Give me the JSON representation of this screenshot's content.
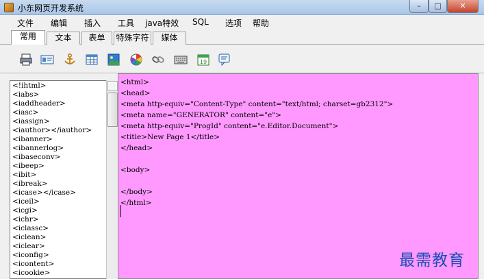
{
  "window": {
    "title": "小东网页开发系统",
    "controls": {
      "minimize": "–",
      "maximize": "□",
      "close": "✕"
    }
  },
  "menu": [
    "文件",
    "编辑",
    "插入",
    "工具",
    "java特效",
    "SQL",
    "选项",
    "帮助"
  ],
  "tabs": [
    {
      "label": "常用",
      "active": true
    },
    {
      "label": "文本",
      "active": false
    },
    {
      "label": "表单",
      "active": false
    },
    {
      "label": "特殊字符",
      "active": false
    },
    {
      "label": "媒体",
      "active": false
    }
  ],
  "toolbar": [
    "printer-icon",
    "id-card-icon",
    "anchor-icon",
    "table-icon",
    "image-icon",
    "color-wheel-icon",
    "link-icon",
    "keyboard-icon",
    "calendar-icon",
    "chat-icon"
  ],
  "calendar_day": "19",
  "tag_list": [
    "<!ihtml>",
    "<iabs>",
    "<iaddheader>",
    "<iasc>",
    "<iassign>",
    "<iauthor></iauthor>",
    "<ibanner>",
    "<ibannerlog>",
    "<ibaseconv>",
    "<ibeep>",
    "<ibit>",
    "<ibreak>",
    "<icase></icase>",
    "<iceil>",
    "<icgi>",
    "<ichr>",
    "<iclassc>",
    "<iclean>",
    "<iclear>",
    "<iconfig>",
    "<icontent>",
    "<icookie>"
  ],
  "editor": {
    "background": "#ff99ff",
    "lines": [
      "<html>",
      "<head>",
      "<meta http-equiv=\"Content-Type\" content=\"text/html; charset=gb2312\">",
      "<meta name=\"GENERATOR\" content=\"e\">",
      "<meta http-equiv=\"ProgId\" content=\"e.Editor.Document\">",
      "<title>New Page 1</title>",
      "</head>",
      "",
      "<body>",
      "",
      "</body>",
      "</html>"
    ]
  },
  "watermark": "最需教育"
}
